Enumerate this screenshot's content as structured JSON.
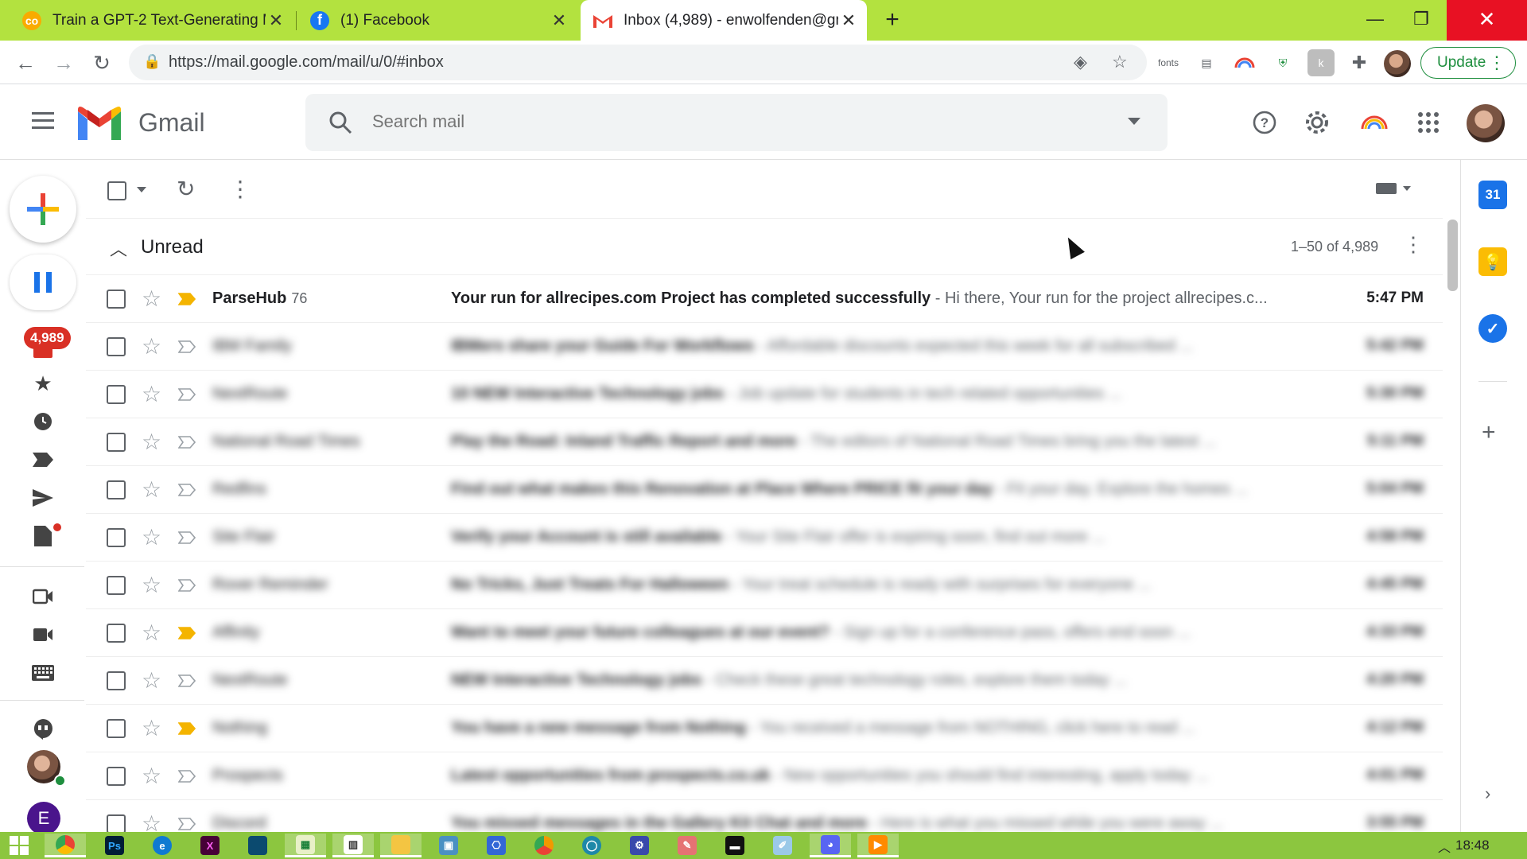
{
  "browser": {
    "tabs": [
      {
        "title": "Train a GPT-2 Text-Generating M",
        "favicon": "colab-icon",
        "favicon_color": "#f9ab00"
      },
      {
        "title": "(1) Facebook",
        "favicon": "facebook-icon",
        "favicon_color": "#1877f2"
      },
      {
        "title": "Inbox (4,989) - enwolfenden@gm",
        "favicon": "gmail-icon",
        "favicon_color": "#ea4335",
        "active": true
      }
    ],
    "url": "https://mail.google.com/mail/u/0/#inbox",
    "extensions": [
      "fonts",
      "css-icon",
      "rainbow-icon",
      "shield-icon",
      "k-icon",
      "puzzle-icon"
    ],
    "update_label": "Update",
    "frame_color": "#b3e23f"
  },
  "gmail": {
    "product_name": "Gmail",
    "search_placeholder": "Search mail",
    "unread_count_badge": "4,989",
    "section_title": "Unread",
    "pagination": "1–50 of 4,989",
    "emails": [
      {
        "sender": "ParseHub",
        "count": "76",
        "subject": "Your run for allrecipes.com Project has completed successfully",
        "snippet": "- Hi there, Your run for the project allrecipes.c...",
        "time": "5:47 PM",
        "important": true,
        "blurred": false
      },
      {
        "sender": "IBM Family",
        "count": "",
        "subject": "IBMers share your Guide For Workflows",
        "snippet": "- Affordable discounts expected this week for all subscribed ...",
        "time": "5:42 PM",
        "important": false,
        "blurred": true
      },
      {
        "sender": "NextRoute",
        "count": "",
        "subject": "10 NEW Interactive Technology jobs",
        "snippet": "- Job update for students in tech related opportunities ...",
        "time": "5:30 PM",
        "important": false,
        "blurred": true
      },
      {
        "sender": "National Road Times",
        "count": "",
        "subject": "Play the Road: Inland Traffic Report and more",
        "snippet": "- The editors of National Road Times bring you the latest ...",
        "time": "5:11 PM",
        "important": false,
        "blurred": true
      },
      {
        "sender": "Redfins",
        "count": "",
        "subject": "Find out what makes this Renovation at Place Where PRICE fit your day",
        "snippet": "- Fit your day. Explore the homes ...",
        "time": "5:04 PM",
        "important": false,
        "blurred": true
      },
      {
        "sender": "Site Flair",
        "count": "",
        "subject": "Verify your Account is still available",
        "snippet": "- Your Site Flair offer is expiring soon, find out more ...",
        "time": "4:58 PM",
        "important": false,
        "blurred": true
      },
      {
        "sender": "Rover Reminder",
        "count": "",
        "subject": "No Tricks, Just Treats For Halloween",
        "snippet": "- Your treat schedule is ready with surprises for everyone ...",
        "time": "4:45 PM",
        "important": false,
        "blurred": true
      },
      {
        "sender": "Affinity",
        "count": "",
        "subject": "Want to meet your future colleagues at our event?",
        "snippet": "- Sign up for a conference pass, offers end soon ...",
        "time": "4:33 PM",
        "important": true,
        "blurred": true
      },
      {
        "sender": "NextRoute",
        "count": "",
        "subject": "NEW Interactive Technology jobs",
        "snippet": "- Check these great technology roles, explore them today ...",
        "time": "4:20 PM",
        "important": false,
        "blurred": true
      },
      {
        "sender": "Nothing",
        "count": "",
        "subject": "You have a new message from Nothing",
        "snippet": "- You received a message from NOTHING, click here to read ...",
        "time": "4:12 PM",
        "important": true,
        "blurred": true
      },
      {
        "sender": "Prospects",
        "count": "",
        "subject": "Latest opportunities from prospects.co.uk",
        "snippet": "- New opportunities you should find interesting, apply today ...",
        "time": "4:01 PM",
        "important": false,
        "blurred": true
      },
      {
        "sender": "Discord",
        "count": "",
        "subject": "You missed messages in the Gallery Kit Chat and more",
        "snippet": "- Here is what you missed while you were away ...",
        "time": "3:55 PM",
        "important": false,
        "blurred": true
      }
    ]
  },
  "taskbar": {
    "clock": "18:48",
    "apps": [
      "windows-start-icon",
      "chrome-icon",
      "photoshop-icon",
      "edge-icon",
      "xd-icon",
      "notebook-icon",
      "sheets-icon",
      "reader-icon",
      "file-explorer-icon",
      "settings-panel-icon",
      "network-icon",
      "chrome-canary-icon",
      "python-icon",
      "gear-app-icon",
      "paint-icon",
      "terminal-icon",
      "notepad-icon",
      "discord-icon",
      "media-icon"
    ]
  }
}
